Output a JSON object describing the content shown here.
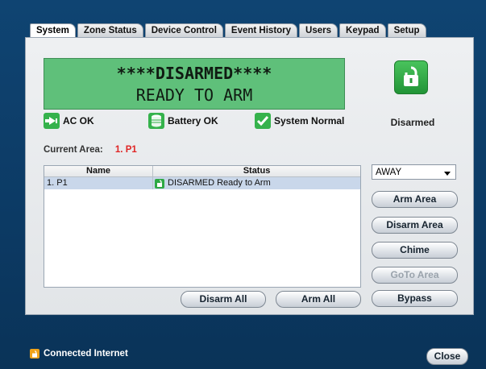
{
  "tabs": [
    {
      "label": "System",
      "active": true
    },
    {
      "label": "Zone Status"
    },
    {
      "label": "Device Control"
    },
    {
      "label": "Event History"
    },
    {
      "label": "Users"
    },
    {
      "label": "Keypad"
    },
    {
      "label": "Setup"
    }
  ],
  "lcd": {
    "line1": "****DISARMED****",
    "line2": "READY TO ARM"
  },
  "status_icon": "lock-open-icon",
  "arm_state_label": "Disarmed",
  "indicators": {
    "ac": "AC OK",
    "battery": "Battery OK",
    "system": "System Normal"
  },
  "current_area": {
    "label": "Current Area:",
    "value": "1. P1"
  },
  "table": {
    "columns": [
      "Name",
      "Status"
    ],
    "rows": [
      {
        "name": "1. P1",
        "status": "DISARMED Ready to Arm"
      }
    ]
  },
  "mode_select": {
    "value": "AWAY"
  },
  "buttons": {
    "arm_area": "Arm Area",
    "disarm_area": "Disarm Area",
    "chime": "Chime",
    "goto_area": "GoTo Area",
    "bypass": "Bypass",
    "disarm_all": "Disarm All",
    "arm_all": "Arm All"
  },
  "footer": {
    "connection": "Connected Internet",
    "close": "Close"
  },
  "colors": {
    "background": "#0c3a64",
    "lcd": "#5fc07a",
    "status_green": "#2ea844",
    "area_red": "#e02424",
    "connection_icon": "#f0a31a"
  }
}
